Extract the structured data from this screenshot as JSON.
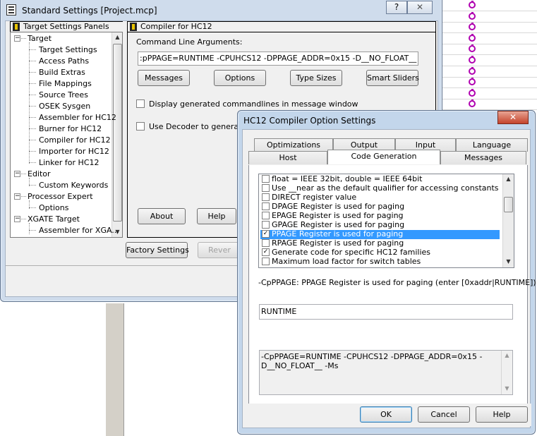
{
  "background": {
    "row_count": 10
  },
  "standard_settings": {
    "title": "Standard Settings [Project.mcp]",
    "help_button": "?",
    "close_button": "✕",
    "panels_header": "Target Settings Panels",
    "tree": [
      {
        "label": "Target",
        "level": 0,
        "expander": "−"
      },
      {
        "label": "Target Settings",
        "level": 1
      },
      {
        "label": "Access Paths",
        "level": 1
      },
      {
        "label": "Build Extras",
        "level": 1
      },
      {
        "label": "File Mappings",
        "level": 1
      },
      {
        "label": "Source Trees",
        "level": 1
      },
      {
        "label": "OSEK Sysgen",
        "level": 1
      },
      {
        "label": "Assembler for HC12",
        "level": 1
      },
      {
        "label": "Burner for HC12",
        "level": 1
      },
      {
        "label": "Compiler for HC12",
        "level": 1
      },
      {
        "label": "Importer for HC12",
        "level": 1
      },
      {
        "label": "Linker for HC12",
        "level": 1
      },
      {
        "label": "Editor",
        "level": 0,
        "expander": "−"
      },
      {
        "label": "Custom Keywords",
        "level": 1
      },
      {
        "label": "Processor Expert",
        "level": 0,
        "expander": "−"
      },
      {
        "label": "Options",
        "level": 1
      },
      {
        "label": "XGATE Target",
        "level": 0,
        "expander": "−"
      },
      {
        "label": "Assembler for XGA...",
        "level": 1
      }
    ],
    "panel_title": "Compiler for HC12",
    "cmdline_label": "Command Line Arguments:",
    "cmdline_value": ":pPPAGE=RUNTIME -CPUHCS12 -DPPAGE_ADDR=0x15 -D__NO_FLOAT__ -Ms",
    "buttons": {
      "messages": "Messages",
      "options": "Options",
      "type_sizes": "Type Sizes",
      "smart_sliders": "Smart Sliders",
      "about": "About",
      "help": "Help",
      "factory_settings": "Factory Settings",
      "revert": "Rever"
    },
    "check_display_cmdlines": "Display generated commandlines in message window",
    "check_use_decoder": "Use Decoder to generate D"
  },
  "hc12_dialog": {
    "title": "HC12 Compiler Option Settings",
    "close_button": "✕",
    "tabs_top": [
      "Optimizations",
      "Output",
      "Input",
      "Language"
    ],
    "tabs_bottom": [
      "Host",
      "Code Generation",
      "Messages"
    ],
    "active_tab": "Code Generation",
    "options": [
      {
        "label": "float = IEEE 32bit, double = IEEE 64bit",
        "checked": false,
        "selected": false
      },
      {
        "label": "Use __near as the default qualifier for accessing constants",
        "checked": false,
        "selected": false
      },
      {
        "label": "DIRECT register value",
        "checked": false,
        "selected": false
      },
      {
        "label": "DPAGE Register is used for paging",
        "checked": false,
        "selected": false
      },
      {
        "label": "EPAGE Register is used for paging",
        "checked": false,
        "selected": false
      },
      {
        "label": "GPAGE Register is used for paging",
        "checked": false,
        "selected": false
      },
      {
        "label": "PPAGE Register is used for paging",
        "checked": true,
        "selected": true
      },
      {
        "label": "RPAGE Register is used for paging",
        "checked": false,
        "selected": false
      },
      {
        "label": "Generate code for specific HC12 families",
        "checked": true,
        "selected": false
      },
      {
        "label": "Maximum load factor for switch tables",
        "checked": false,
        "selected": false
      }
    ],
    "description": "-CpPPAGE: PPAGE Register is used for paging (enter [0xaddr|RUNTIME])",
    "value_input": "RUNTIME",
    "command_preview": "-CpPPAGE=RUNTIME -CPUHCS12 -DPPAGE_ADDR=0x15 -D__NO_FLOAT__ -Ms",
    "ok": "OK",
    "cancel": "Cancel",
    "help": "Help"
  }
}
